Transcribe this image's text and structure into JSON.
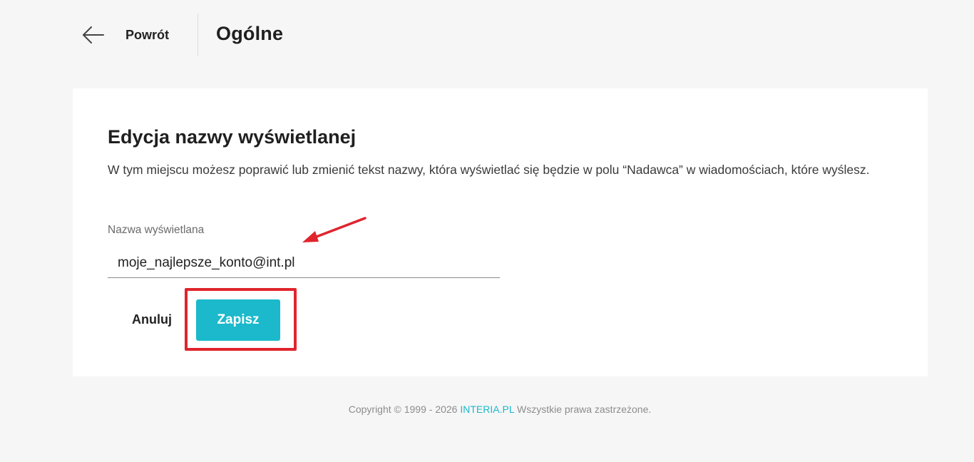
{
  "header": {
    "back_label": "Powrót",
    "title": "Ogólne",
    "back_icon": "arrow-left-icon"
  },
  "card": {
    "title": "Edycja nazwy wyświetlanej",
    "description": "W tym miejscu możesz poprawić lub zmienić tekst nazwy, która wyświetlać się będzie w polu “Nadawca” w wiadomościach, które wyślesz.",
    "field": {
      "label": "Nazwa wyświetlana",
      "value": "moje_najlepsze_konto@int.pl"
    },
    "buttons": {
      "cancel_label": "Anuluj",
      "save_label": "Zapisz"
    }
  },
  "annotations": {
    "arrow_icon": "red-arrow-icon",
    "highlight_color": "#e0242d"
  },
  "footer": {
    "prefix": "Copyright © 1999 - 2026",
    "link": "INTERIA.PL",
    "suffix": "Wszystkie prawa zastrzeżone."
  },
  "colors": {
    "accent": "#1bb9cb",
    "background": "#f6f6f6",
    "card": "#ffffff",
    "annotation": "#e0242d"
  }
}
